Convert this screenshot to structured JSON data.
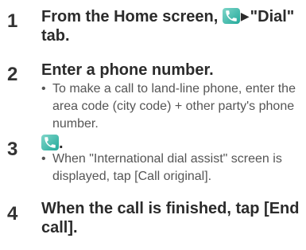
{
  "steps": [
    {
      "number": "1",
      "title_before": "From the Home screen,",
      "title_after": "\"Dial\" tab.",
      "icon": "phone-icon",
      "arrow": "▶"
    },
    {
      "number": "2",
      "title": "Enter a phone number.",
      "bullet": "•",
      "note": "To make a call to land-line phone, enter the area code (city code) + other party's phone number."
    },
    {
      "number": "3",
      "icon": "phone-icon",
      "title_after": ".",
      "bullet": "•",
      "note": "When \"International dial assist\" screen is displayed, tap [Call original]."
    },
    {
      "number": "4",
      "title": "When the call is finished, tap [End call]."
    }
  ],
  "colors": {
    "icon_start": "#7fd6c9",
    "icon_end": "#23a99a",
    "text": "#2b2b2b",
    "note_text": "#555555"
  }
}
